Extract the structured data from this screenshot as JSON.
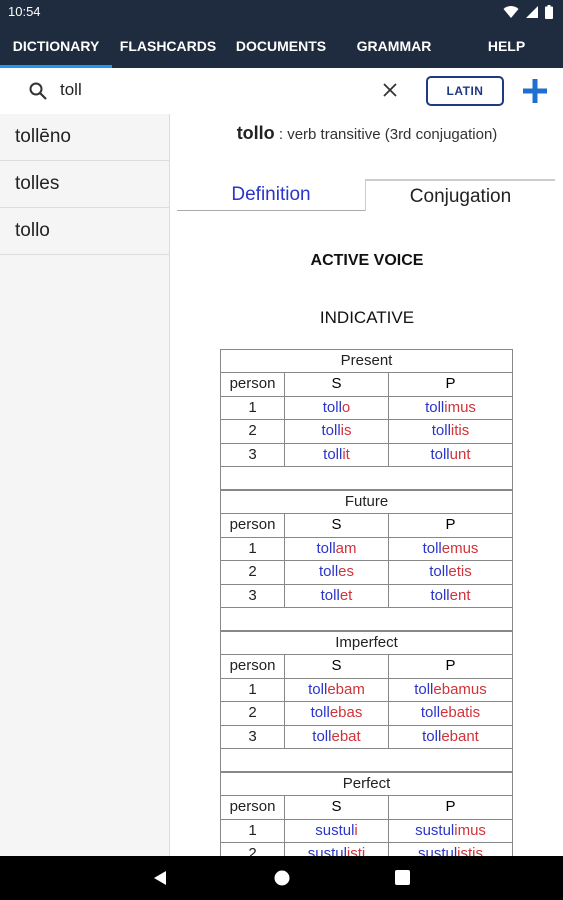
{
  "status": {
    "time": "10:54"
  },
  "tabs": [
    "DICTIONARY",
    "FLASHCARDS",
    "DOCUMENTS",
    "GRAMMAR",
    "HELP"
  ],
  "search": {
    "query": "toll",
    "language_button": "LATIN"
  },
  "sidebar": {
    "items": [
      "tollēno",
      "tolles",
      "tollo"
    ]
  },
  "entry": {
    "word": "tollo",
    "description": " : verb transitive (3rd conjugation)"
  },
  "detail_tabs": {
    "definition": "Definition",
    "conjugation": "Conjugation"
  },
  "voice": "ACTIVE VOICE",
  "mood": "INDICATIVE",
  "table_headers": {
    "person": "person",
    "singular": "S",
    "plural": "P"
  },
  "tenses": [
    {
      "name": "Present",
      "rows": [
        {
          "person": "1",
          "s": [
            "toll",
            "o"
          ],
          "p": [
            "toll",
            "imus"
          ]
        },
        {
          "person": "2",
          "s": [
            "toll",
            "is"
          ],
          "p": [
            "toll",
            "itis"
          ]
        },
        {
          "person": "3",
          "s": [
            "toll",
            "it"
          ],
          "p": [
            "toll",
            "unt"
          ]
        }
      ]
    },
    {
      "name": "Future",
      "rows": [
        {
          "person": "1",
          "s": [
            "toll",
            "am"
          ],
          "p": [
            "toll",
            "emus"
          ]
        },
        {
          "person": "2",
          "s": [
            "toll",
            "es"
          ],
          "p": [
            "toll",
            "etis"
          ]
        },
        {
          "person": "3",
          "s": [
            "toll",
            "et"
          ],
          "p": [
            "toll",
            "ent"
          ]
        }
      ]
    },
    {
      "name": "Imperfect",
      "rows": [
        {
          "person": "1",
          "s": [
            "toll",
            "ebam"
          ],
          "p": [
            "toll",
            "ebamus"
          ]
        },
        {
          "person": "2",
          "s": [
            "toll",
            "ebas"
          ],
          "p": [
            "toll",
            "ebatis"
          ]
        },
        {
          "person": "3",
          "s": [
            "toll",
            "ebat"
          ],
          "p": [
            "toll",
            "ebant"
          ]
        }
      ]
    },
    {
      "name": "Perfect",
      "rows": [
        {
          "person": "1",
          "s": [
            "sustul",
            "i"
          ],
          "p": [
            "sustul",
            "imus"
          ]
        },
        {
          "person": "2",
          "s": [
            "sustul",
            "isti"
          ],
          "p": [
            "sustul",
            "istis"
          ]
        }
      ]
    }
  ],
  "colors": {
    "stem": "#2a35c9",
    "ending": "#d0333a",
    "appbar": "#1f2b3e",
    "accent": "#2196f3"
  },
  "icons": [
    "search-icon",
    "clear-icon",
    "add-icon",
    "wifi-icon",
    "signal-icon",
    "battery-icon",
    "back-icon",
    "home-icon",
    "recents-icon"
  ]
}
